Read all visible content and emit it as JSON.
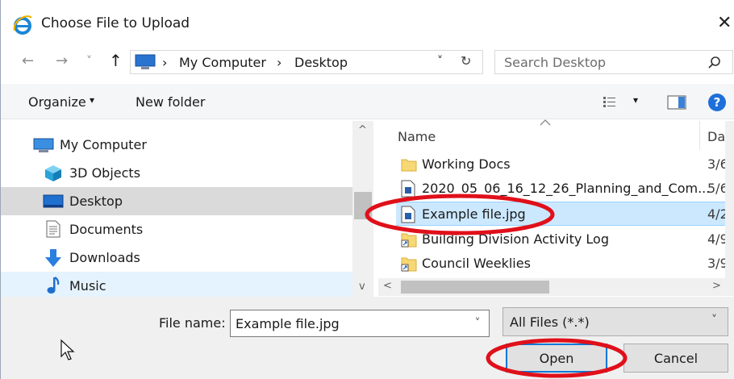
{
  "window": {
    "title": "Choose File to Upload",
    "close_glyph": "✕",
    "app_icon": "internet-explorer-icon"
  },
  "address": {
    "back": "←",
    "forward": "→",
    "history": "˅",
    "up": "↑",
    "crumbs": [
      "My Computer",
      "Desktop"
    ],
    "separator": "›",
    "dropdown": "˅",
    "refresh": "↻"
  },
  "search": {
    "placeholder": "Search Desktop"
  },
  "toolbar": {
    "organize_label": "Organize",
    "organize_caret": "▾",
    "new_folder_label": "New folder",
    "view_caret": "▾",
    "help_label": "?"
  },
  "nav": {
    "items": [
      {
        "label": "My Computer",
        "icon": "computer-icon",
        "state": "normal"
      },
      {
        "label": "3D Objects",
        "icon": "cube-icon",
        "state": "normal"
      },
      {
        "label": "Desktop",
        "icon": "desktop-icon",
        "state": "selected"
      },
      {
        "label": "Documents",
        "icon": "document-icon",
        "state": "normal"
      },
      {
        "label": "Downloads",
        "icon": "download-icon",
        "state": "normal"
      },
      {
        "label": "Music",
        "icon": "music-note-icon",
        "state": "hover"
      }
    ],
    "scroll_up": "^",
    "scroll_down": "v"
  },
  "files": {
    "columns": {
      "name": "Name",
      "date": "Dat"
    },
    "rows": [
      {
        "name": "Working Docs",
        "date": "3/6",
        "icon": "folder-icon",
        "selected": false
      },
      {
        "name": "2020_05_06_16_12_26_Planning_and_Com...",
        "date": "5/6",
        "icon": "file-icon",
        "selected": false
      },
      {
        "name": "Example file.jpg",
        "date": "4/2",
        "icon": "image-file-icon",
        "selected": true
      },
      {
        "name": "Building Division Activity Log",
        "date": "4/9",
        "icon": "shortcut-icon",
        "selected": false
      },
      {
        "name": "Council Weeklies",
        "date": "3/9",
        "icon": "shortcut-icon",
        "selected": false
      }
    ],
    "scroll_left": "<",
    "scroll_right": ">"
  },
  "bottom": {
    "file_name_label": "File name:",
    "file_name_value": "Example file.jpg",
    "file_name_caret": "˅",
    "filter_value": "All Files (*.*)",
    "filter_caret": "˅",
    "open_label": "Open",
    "cancel_label": "Cancel"
  },
  "annotation": {
    "ellipse_color": "#e0101a"
  }
}
